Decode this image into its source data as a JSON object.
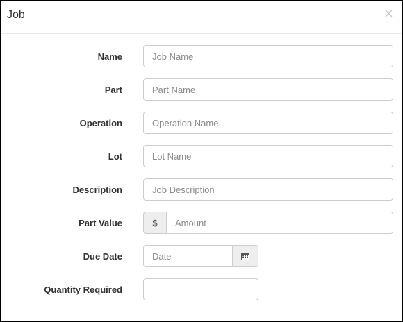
{
  "modal": {
    "title": "Job",
    "close_glyph": "×"
  },
  "form": {
    "name": {
      "label": "Name",
      "placeholder": "Job Name",
      "value": ""
    },
    "part": {
      "label": "Part",
      "placeholder": "Part Name",
      "value": ""
    },
    "operation": {
      "label": "Operation",
      "placeholder": "Operation Name",
      "value": ""
    },
    "lot": {
      "label": "Lot",
      "placeholder": "Lot Name",
      "value": ""
    },
    "description": {
      "label": "Description",
      "placeholder": "Job Description",
      "value": ""
    },
    "part_value": {
      "label": "Part Value",
      "prefix": "$",
      "placeholder": "Amount",
      "value": ""
    },
    "due_date": {
      "label": "Due Date",
      "placeholder": "Date",
      "value": "",
      "icon": "calendar-icon"
    },
    "quantity_required": {
      "label": "Quantity Required",
      "placeholder": "",
      "value": ""
    }
  }
}
